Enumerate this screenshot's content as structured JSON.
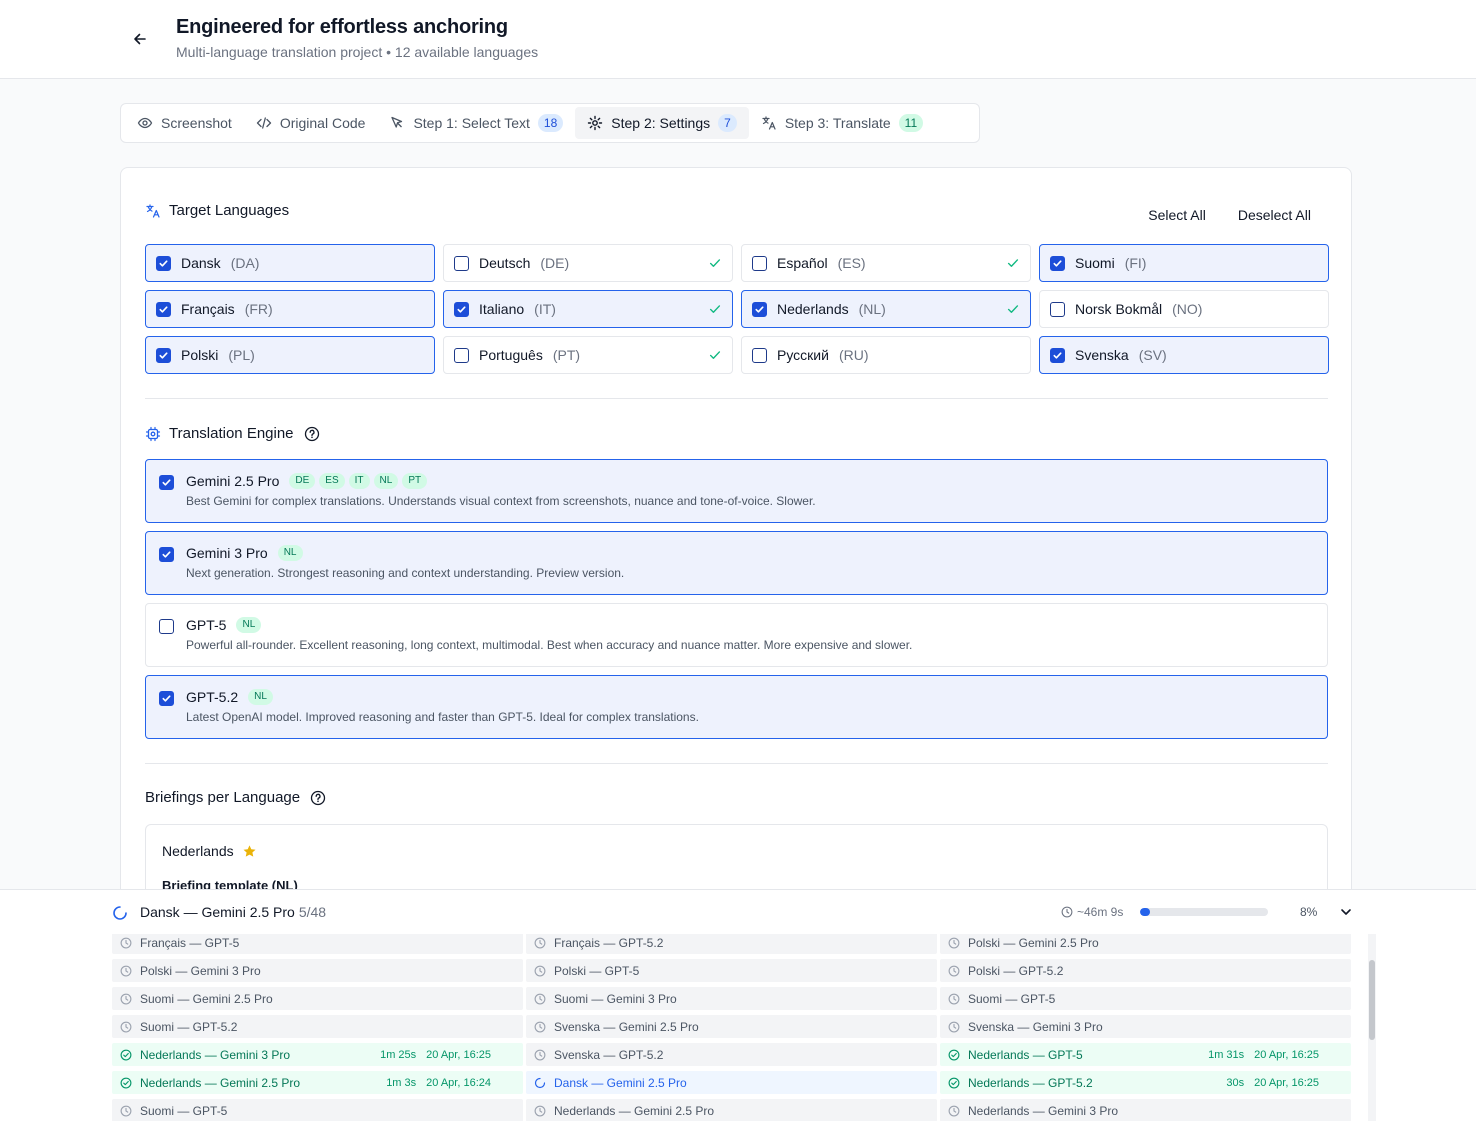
{
  "header": {
    "title": "Engineered for effortless anchoring",
    "subtitle": "Multi-language translation project • 12 available languages"
  },
  "tabs": [
    {
      "label": "Screenshot",
      "icon": "eye-icon"
    },
    {
      "label": "Original Code",
      "icon": "code-icon"
    },
    {
      "label": "Step 1: Select Text",
      "icon": "cursor-icon",
      "count": "18"
    },
    {
      "label": "Step 2: Settings",
      "icon": "gear-icon",
      "count": "7",
      "active": true
    },
    {
      "label": "Step 3: Translate",
      "icon": "translate-icon",
      "count": "11"
    }
  ],
  "target_languages": {
    "heading": "Target Languages",
    "select_all": "Select All",
    "deselect_all": "Deselect All",
    "items": [
      {
        "name": "Dansk",
        "code": "(DA)",
        "checked": true,
        "done": false
      },
      {
        "name": "Deutsch",
        "code": "(DE)",
        "checked": false,
        "done": true
      },
      {
        "name": "Español",
        "code": "(ES)",
        "checked": false,
        "done": true
      },
      {
        "name": "Suomi",
        "code": "(FI)",
        "checked": true,
        "done": false
      },
      {
        "name": "Français",
        "code": "(FR)",
        "checked": true,
        "done": false
      },
      {
        "name": "Italiano",
        "code": "(IT)",
        "checked": true,
        "done": true
      },
      {
        "name": "Nederlands",
        "code": "(NL)",
        "checked": true,
        "done": true
      },
      {
        "name": "Norsk Bokmål",
        "code": "(NO)",
        "checked": false,
        "done": false
      },
      {
        "name": "Polski",
        "code": "(PL)",
        "checked": true,
        "done": false
      },
      {
        "name": "Português",
        "code": "(PT)",
        "checked": false,
        "done": true
      },
      {
        "name": "Русский",
        "code": "(RU)",
        "checked": false,
        "done": false
      },
      {
        "name": "Svenska",
        "code": "(SV)",
        "checked": true,
        "done": false
      }
    ]
  },
  "engine": {
    "heading": "Translation Engine",
    "items": [
      {
        "name": "Gemini 2.5 Pro",
        "badges": [
          "DE",
          "ES",
          "IT",
          "NL",
          "PT"
        ],
        "desc": "Best Gemini for complex translations. Understands visual context from screenshots, nuance and tone-of-voice. Slower.",
        "checked": true
      },
      {
        "name": "Gemini 3 Pro",
        "badges": [
          "NL"
        ],
        "desc": "Next generation. Strongest reasoning and context understanding. Preview version.",
        "checked": true
      },
      {
        "name": "GPT-5",
        "badges": [
          "NL"
        ],
        "desc": "Powerful all-rounder. Excellent reasoning, long context, multimodal. Best when accuracy and nuance matter. More expensive and slower.",
        "checked": false
      },
      {
        "name": "GPT-5.2",
        "badges": [
          "NL"
        ],
        "desc": "Latest OpenAI model. Improved reasoning and faster than GPT-5. Ideal for complex translations.",
        "checked": true
      }
    ]
  },
  "briefings": {
    "heading": "Briefings per Language",
    "language": "Nederlands",
    "template_label": "Briefing template (NL)"
  },
  "progress": {
    "title": "Dansk — Gemini 2.5 Pro",
    "count": "5/48",
    "eta": "~46m 9s",
    "percent": "8%",
    "fraction": 0.08,
    "jobs": [
      {
        "label": "Français — GPT-5",
        "status": "pending"
      },
      {
        "label": "Français — GPT-5.2",
        "status": "pending"
      },
      {
        "label": "Polski — Gemini 2.5 Pro",
        "status": "pending"
      },
      {
        "label": "Polski — Gemini 3 Pro",
        "status": "pending"
      },
      {
        "label": "Polski — GPT-5",
        "status": "pending"
      },
      {
        "label": "Polski — GPT-5.2",
        "status": "pending"
      },
      {
        "label": "Suomi — Gemini 2.5 Pro",
        "status": "pending"
      },
      {
        "label": "Suomi — Gemini 3 Pro",
        "status": "pending"
      },
      {
        "label": "Suomi — GPT-5",
        "status": "pending"
      },
      {
        "label": "Suomi — GPT-5.2",
        "status": "pending"
      },
      {
        "label": "Svenska — Gemini 2.5 Pro",
        "status": "pending"
      },
      {
        "label": "Svenska — Gemini 3 Pro",
        "status": "pending"
      },
      {
        "label": "Nederlands — Gemini 3 Pro",
        "status": "done",
        "duration": "1m 25s",
        "time": "20 Apr, 16:25"
      },
      {
        "label": "Svenska — GPT-5.2",
        "status": "pending"
      },
      {
        "label": "Nederlands — GPT-5",
        "status": "done",
        "duration": "1m 31s",
        "time": "20 Apr, 16:25"
      },
      {
        "label": "Nederlands — Gemini 2.5 Pro",
        "status": "done",
        "duration": "1m 3s",
        "time": "20 Apr, 16:24"
      },
      {
        "label": "Dansk — Gemini 2.5 Pro",
        "status": "running"
      },
      {
        "label": "Nederlands — GPT-5.2",
        "status": "done",
        "duration": "30s",
        "time": "20 Apr, 16:25"
      },
      {
        "label": "Suomi — GPT-5",
        "status": "pending"
      },
      {
        "label": "Nederlands — Gemini 2.5 Pro",
        "status": "pending"
      },
      {
        "label": "Nederlands — Gemini 3 Pro",
        "status": "pending"
      }
    ]
  },
  "colors": {
    "accent": "#2563eb",
    "success": "#059669",
    "star": "#eab308"
  }
}
